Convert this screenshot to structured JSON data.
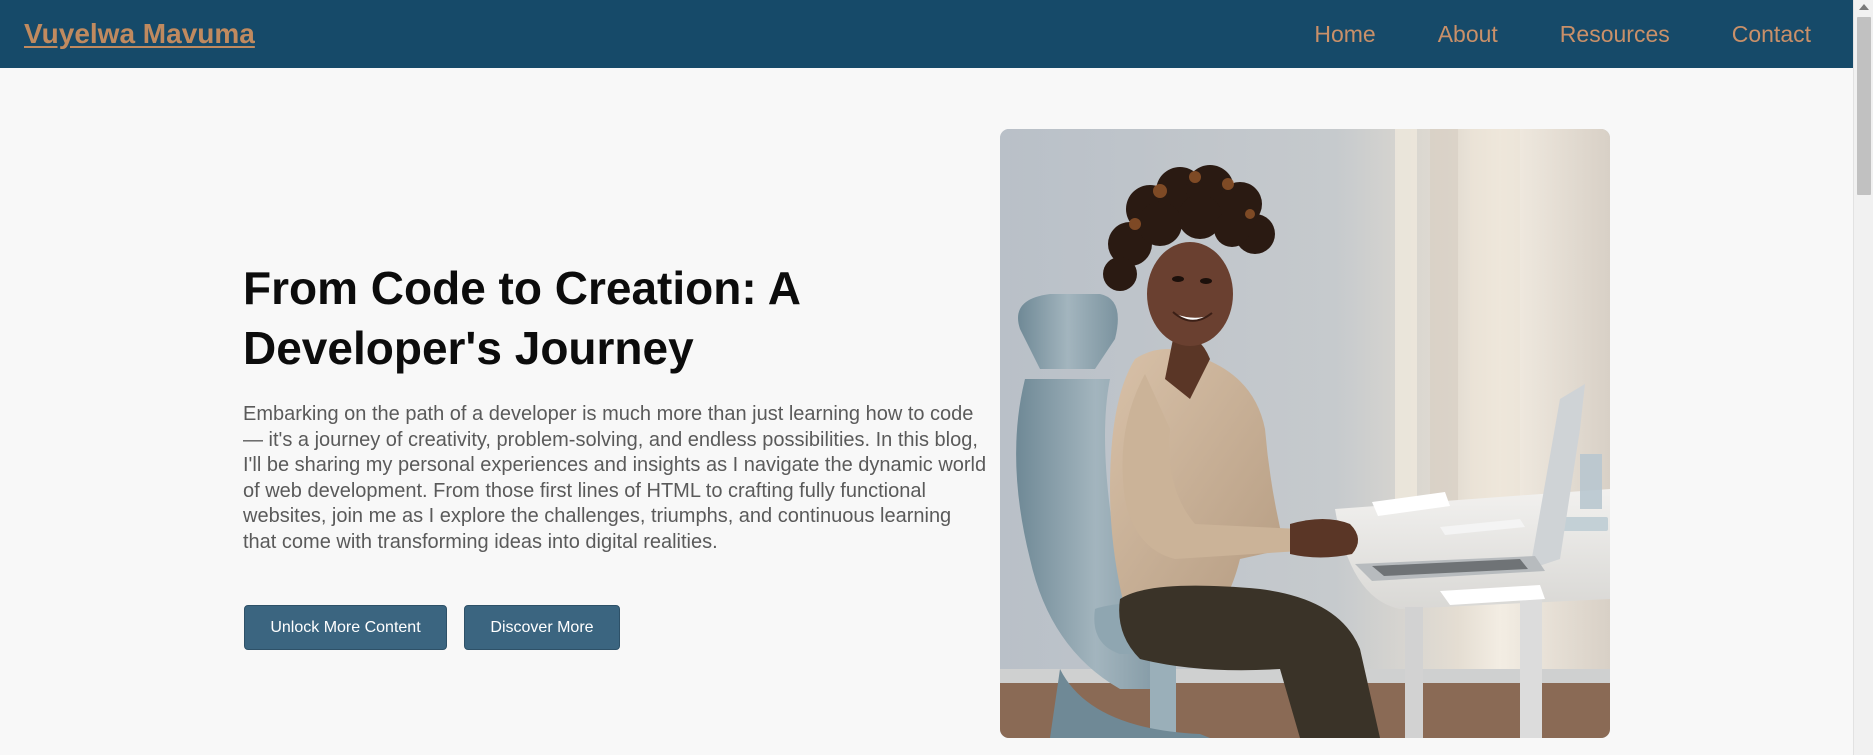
{
  "header": {
    "brand": "Vuyelwa Mavuma",
    "nav": [
      "Home",
      "About",
      "Resources",
      "Contact"
    ]
  },
  "hero": {
    "title": "From Code to Creation: A Developer's Journey",
    "body": "Embarking on the path of a developer is much more than just learning how to code— it's a journey of creativity, problem-solving, and endless possibilities. In this blog, I'll be sharing my personal experiences and insights as I navigate the dynamic world of web development. From those first lines of HTML to crafting fully functional websites, join me as I explore the challenges, triumphs, and continuous learning that come with transforming ideas into digital realities.",
    "buttons": {
      "unlock": "Unlock More Content",
      "discover": "Discover More"
    }
  },
  "colors": {
    "header_bg": "#164a69",
    "accent": "#c99069",
    "button_bg": "#3b6580",
    "page_bg": "#f8f8f8"
  },
  "icons": {
    "scroll_up": "chevron-up-icon"
  }
}
